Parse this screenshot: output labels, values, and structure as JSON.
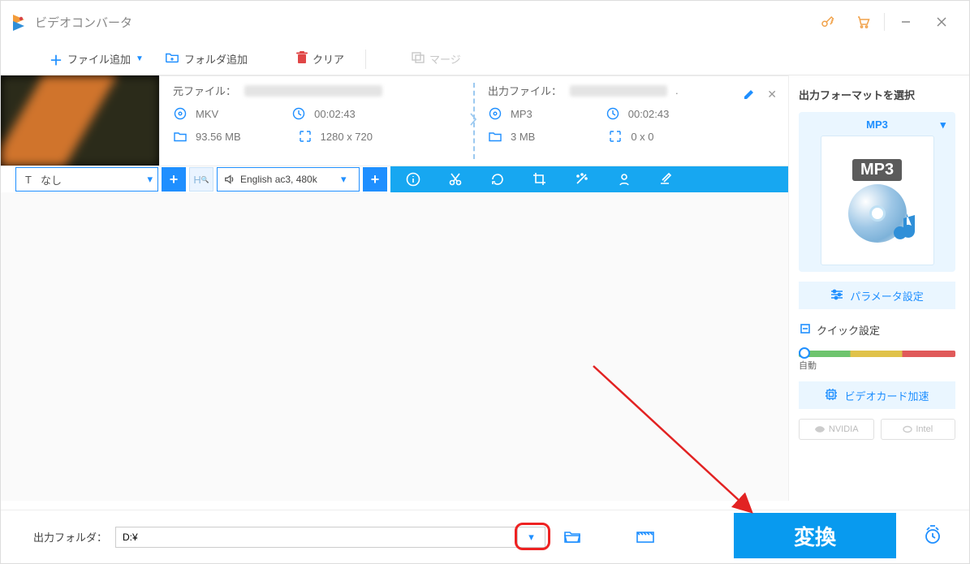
{
  "titlebar": {
    "title": "ビデオコンバータ"
  },
  "toolbar": {
    "add_file": "ファイル追加",
    "add_folder": "フォルダ追加",
    "clear": "クリア",
    "merge": "マージ"
  },
  "file": {
    "source": {
      "label": "元ファイル：",
      "format": "MKV",
      "duration": "00:02:43",
      "size": "93.56 MB",
      "resolution": "1280 x 720"
    },
    "output": {
      "label": "出力ファイル：",
      "format": "MP3",
      "duration": "00:02:43",
      "size": "3 MB",
      "resolution": "0 x 0"
    }
  },
  "subtitle": {
    "value": "なし"
  },
  "audio": {
    "value": "English ac3, 480k"
  },
  "sidebar": {
    "title": "出力フォーマットを選択",
    "format": "MP3",
    "format_badge": "MP3",
    "param_settings": "パラメータ設定",
    "quick_settings": "クイック設定",
    "slider_label": "自動",
    "accel": "ビデオカード加速",
    "nvidia": "NVIDIA",
    "intel": "Intel"
  },
  "bottom": {
    "label": "出力フォルダ：",
    "path": "D:¥",
    "convert": "変換"
  }
}
